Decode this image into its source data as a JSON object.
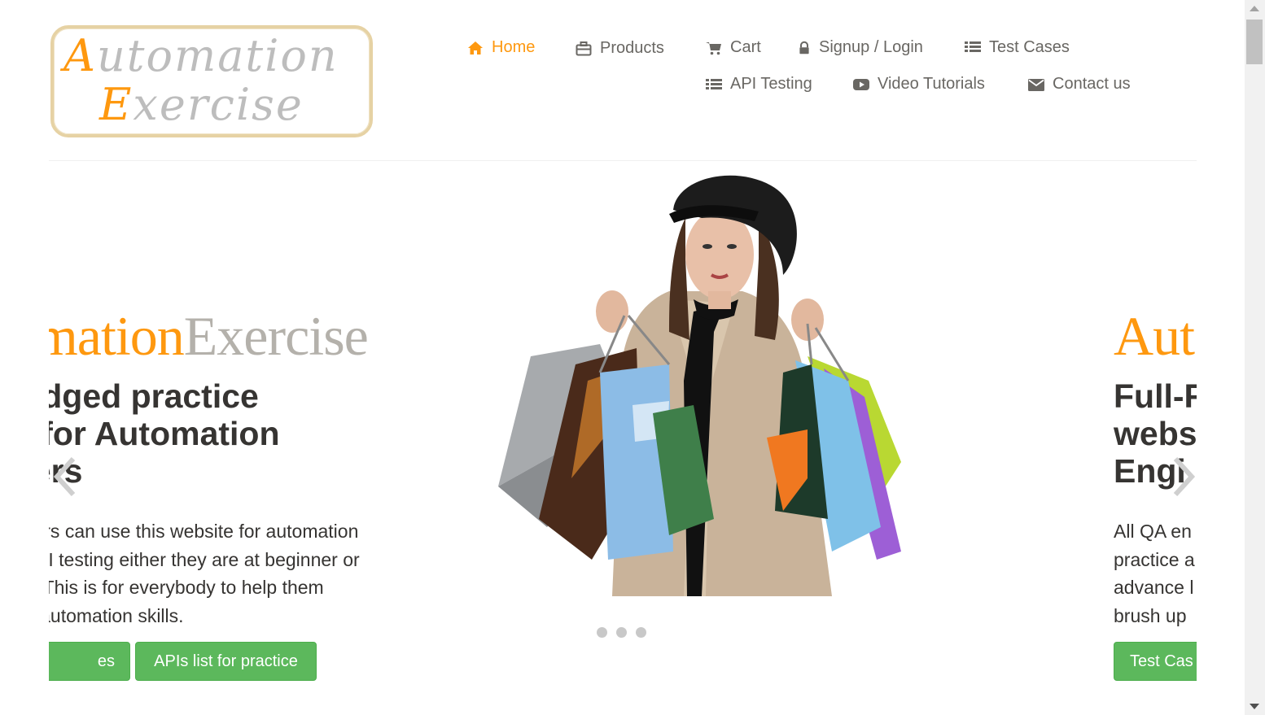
{
  "logo": {
    "line1_cap": "A",
    "line1_rest": "utomation",
    "line2_cap": "E",
    "line2_rest": "xercise"
  },
  "nav": {
    "items": [
      {
        "label": "Home",
        "icon": "home-icon",
        "active": true
      },
      {
        "label": "Products",
        "icon": "briefcase-icon"
      },
      {
        "label": "Cart",
        "icon": "shopping-cart-icon"
      },
      {
        "label": "Signup / Login",
        "icon": "lock-icon"
      },
      {
        "label": "Test Cases",
        "icon": "list-icon"
      },
      {
        "label": "API Testing",
        "icon": "list-icon"
      },
      {
        "label": "Video Tutorials",
        "icon": "youtube-play-icon"
      },
      {
        "label": "Contact us",
        "icon": "envelope-icon"
      }
    ]
  },
  "slider": {
    "current": {
      "brand_orange": "tomation",
      "brand_gray": "Exercise",
      "heading": [
        "Fledged practice",
        "ite for Automation",
        "neers"
      ],
      "text": [
        "gineers can use this website for automation",
        "nd API testing either they are at beginner or",
        "evel. This is for everybody to help them",
        "their automation skills."
      ],
      "button1": "es",
      "button2": "APIs list for practice"
    },
    "next": {
      "brand_orange": "Aut",
      "heading": [
        "Full-F",
        "webs",
        "Engi"
      ],
      "text": [
        "All QA en",
        "practice a",
        "advance l",
        "brush up"
      ],
      "button1": "Test Cas"
    },
    "dots": 3
  },
  "colors": {
    "accent": "#fe980f",
    "button_green": "#5cb85c",
    "brand_gray": "#b4b1ab",
    "text_dark": "#363432",
    "nav_text": "#696763"
  }
}
